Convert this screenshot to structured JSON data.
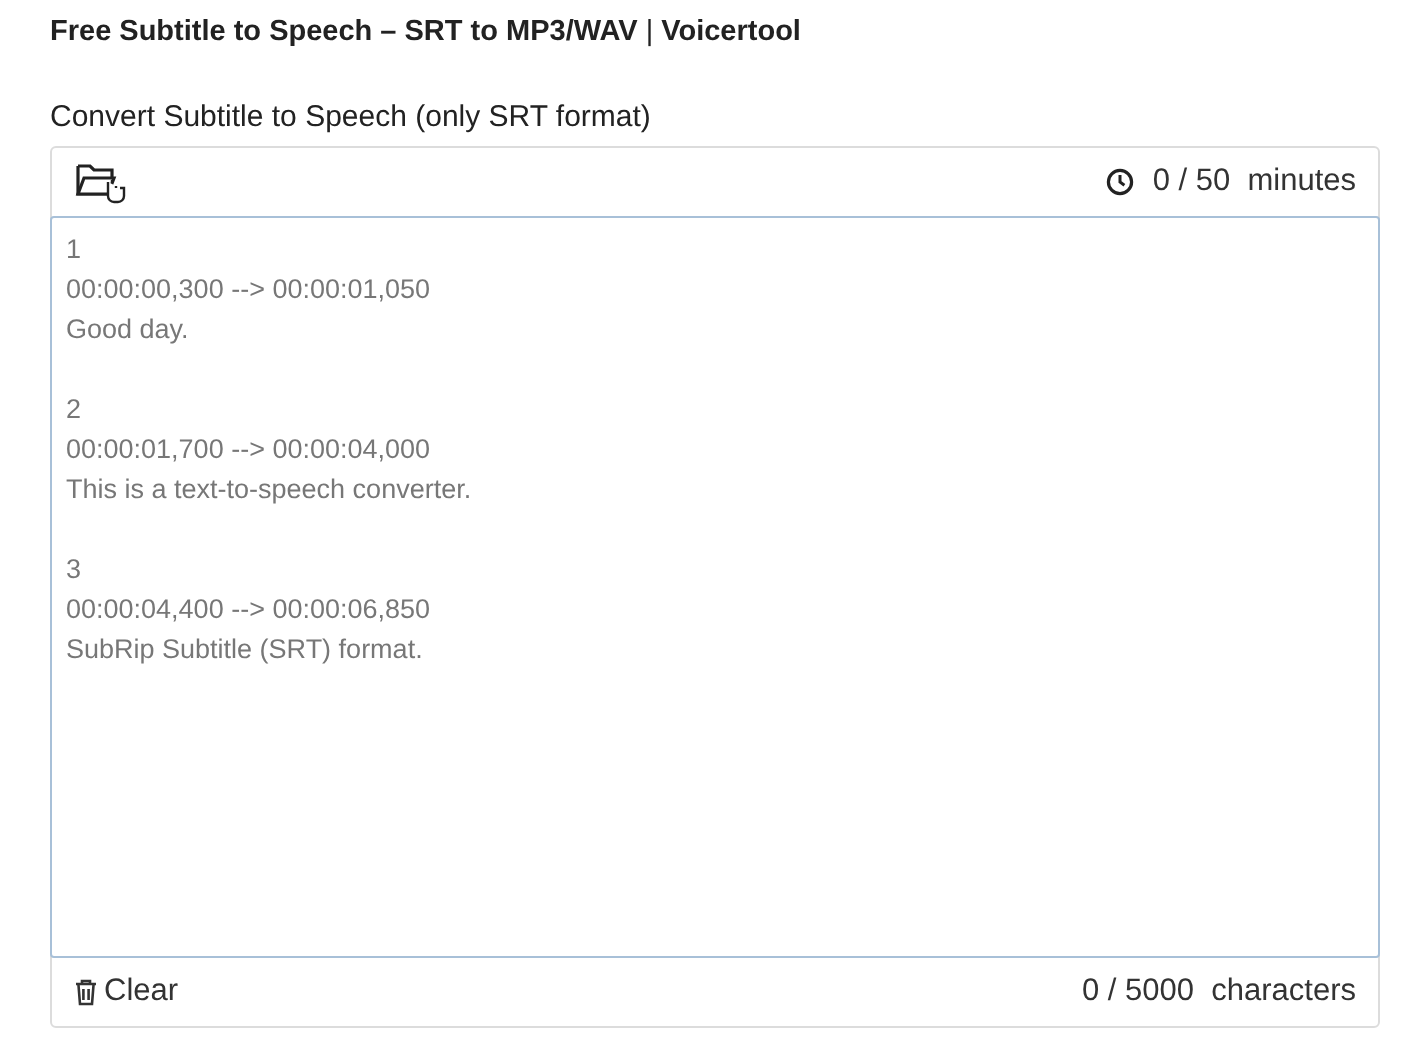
{
  "page_title": "**Free Subtitle to Speech – SRT to MP3/WAV** | **Voicertool**",
  "field_label": "Convert Subtitle to Speech (only SRT format)",
  "duration": "0 / 50  minutes",
  "subtitle_entries": [
    {
      "index": "1",
      "timing": "00:00:00,300 --> 00:00:01,050",
      "text": "Good day."
    },
    {
      "index": "2",
      "timing": "00:00:01,700 --> 00:00:04,000",
      "text": "This is a text-to-speech converter."
    },
    {
      "index": "3",
      "timing": "00:00:04,400 --> 00:00:06,850",
      "text": "SubRip Subtitle (SRT) format."
    }
  ],
  "clear_button": "Clear",
  "character_count": "0 / 5000  characters"
}
